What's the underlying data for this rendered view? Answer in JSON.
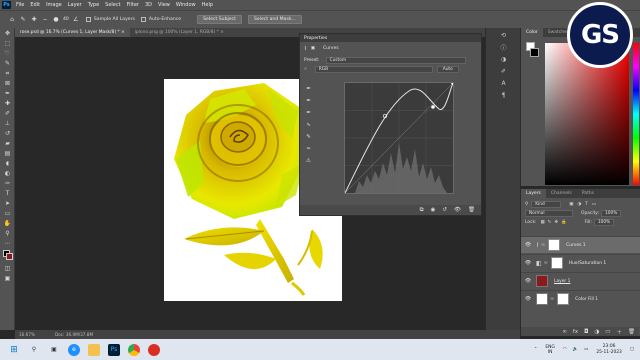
{
  "menubar": {
    "logo": "Ps",
    "items": [
      "File",
      "Edit",
      "Image",
      "Layer",
      "Type",
      "Select",
      "Filter",
      "3D",
      "View",
      "Window",
      "Help"
    ]
  },
  "options": {
    "brush_size": "40",
    "sample_all_layers": "Sample All Layers",
    "auto_enhance": "Auto-Enhance",
    "select_subject": "Select Subject",
    "select_and_mask": "Select and Mask..."
  },
  "tabs": [
    {
      "label": "rose.psd @ 16.7% (Curves 1, Layer Mask/8) * ×"
    },
    {
      "label": "iplono.png @ 100% (Layer 1, RGB/8) * ×"
    }
  ],
  "status": {
    "zoom": "16.67%",
    "doc": "Doc: 36.0M/37.8M"
  },
  "properties": {
    "title": "Properties",
    "adjustment": "Curves",
    "preset_label": "Preset:",
    "preset_value": "Custom",
    "channel_value": "RGB",
    "auto_label": "Auto"
  },
  "color_panel": {
    "tabs": [
      "Color",
      "Swatches"
    ]
  },
  "layers_panel": {
    "tabs": [
      "Layers",
      "Channels",
      "Paths"
    ],
    "filter_kind": "Kind",
    "blend_mode": "Normal",
    "opacity_label": "Opacity:",
    "opacity_value": "100%",
    "lock_label": "Lock:",
    "fill_label": "Fill:",
    "fill_value": "100%",
    "layers": [
      {
        "name": "Curves 1",
        "selected": true
      },
      {
        "name": "Hue/Saturation 1",
        "selected": false
      },
      {
        "name": "Layer 1",
        "selected": false
      },
      {
        "name": "Color Fill 1",
        "selected": false
      }
    ]
  },
  "taskbar": {
    "lang": "ENG",
    "lang2": "IN",
    "time": "23:06",
    "date": "25-11-2023"
  },
  "logo": {
    "text": "GS"
  },
  "colors": {
    "accent": "#31a8ff",
    "panel": "#535353",
    "canvas_bg": "#282828",
    "layer1_thumb": "#8b1a1a"
  }
}
